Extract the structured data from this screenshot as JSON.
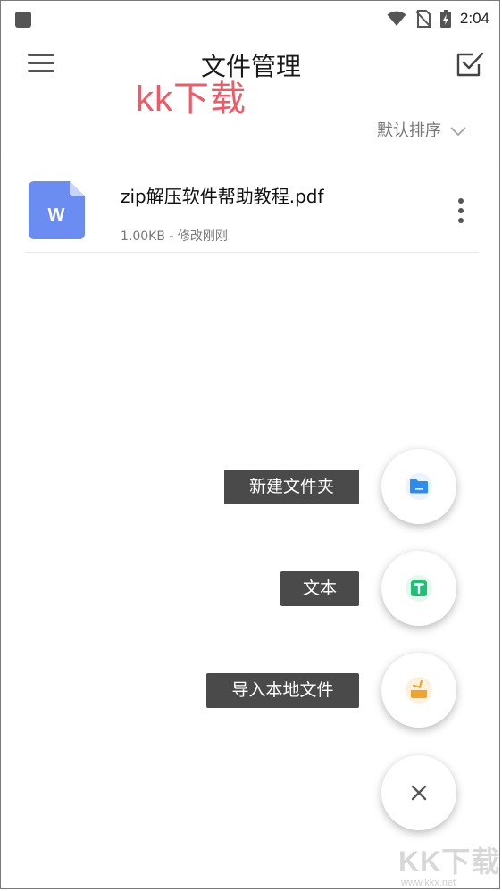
{
  "status_bar": {
    "time": "2:04",
    "icons": [
      "app-notification-icon",
      "wifi-icon",
      "no-sim-icon",
      "battery-charging-icon"
    ]
  },
  "header": {
    "title": "文件管理",
    "menu_icon": "hamburger-menu-icon",
    "select_icon": "checkbox-select-icon"
  },
  "watermark": {
    "text": "kk下载",
    "color": "#ef4b5a"
  },
  "sort": {
    "label": "默认排序",
    "icon": "chevron-down-icon"
  },
  "files": [
    {
      "name": "zip解压软件帮助教程.pdf",
      "meta": "1.00KB - 修改刚刚",
      "icon": "word-document-icon",
      "icon_letter": "W",
      "icon_color": "#6b8cf0"
    }
  ],
  "fab_menu": {
    "items": [
      {
        "label": "新建文件夹",
        "icon": "folder-icon",
        "color": "#2d8cf0"
      },
      {
        "label": "文本",
        "icon": "text-document-icon",
        "color": "#1fbf75"
      },
      {
        "label": "导入本地文件",
        "icon": "import-icon",
        "color": "#f0a52a"
      }
    ],
    "close_icon": "close-icon"
  },
  "footer_watermark": {
    "text": "KK下载",
    "url": "www.kkx.net"
  }
}
